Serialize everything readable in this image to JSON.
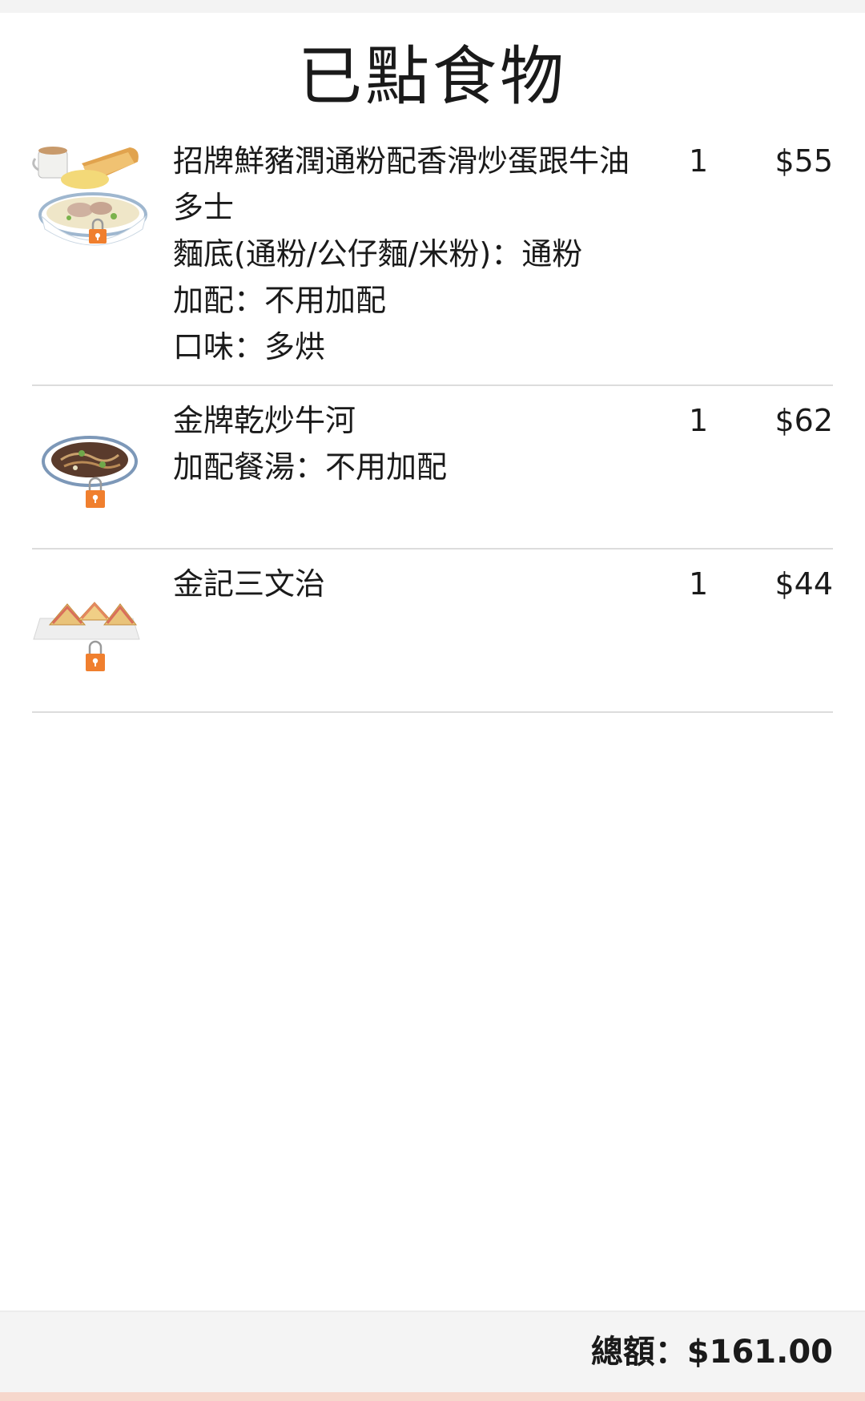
{
  "header": {
    "title": "已點食物"
  },
  "colors": {
    "lock": "#f07f2e",
    "divider": "#dcdcdc",
    "footer_bg": "#f4f4f4"
  },
  "items": [
    {
      "name": "招牌鮮豬潤通粉配香滑炒蛋跟牛油多士",
      "options": [
        "麵底(通粉/公仔麵/米粉)：通粉",
        "加配：不用加配",
        "口味：多烘"
      ],
      "quantity": "1",
      "price": "$55",
      "icon": "noodle-set-image"
    },
    {
      "name": "金牌乾炒牛河",
      "options": [
        "加配餐湯：不用加配"
      ],
      "quantity": "1",
      "price": "$62",
      "icon": "fried-beef-noodle-image"
    },
    {
      "name": "金記三文治",
      "options": [],
      "quantity": "1",
      "price": "$44",
      "icon": "sandwich-image"
    }
  ],
  "footer": {
    "total_label": "總額：$161.00"
  }
}
